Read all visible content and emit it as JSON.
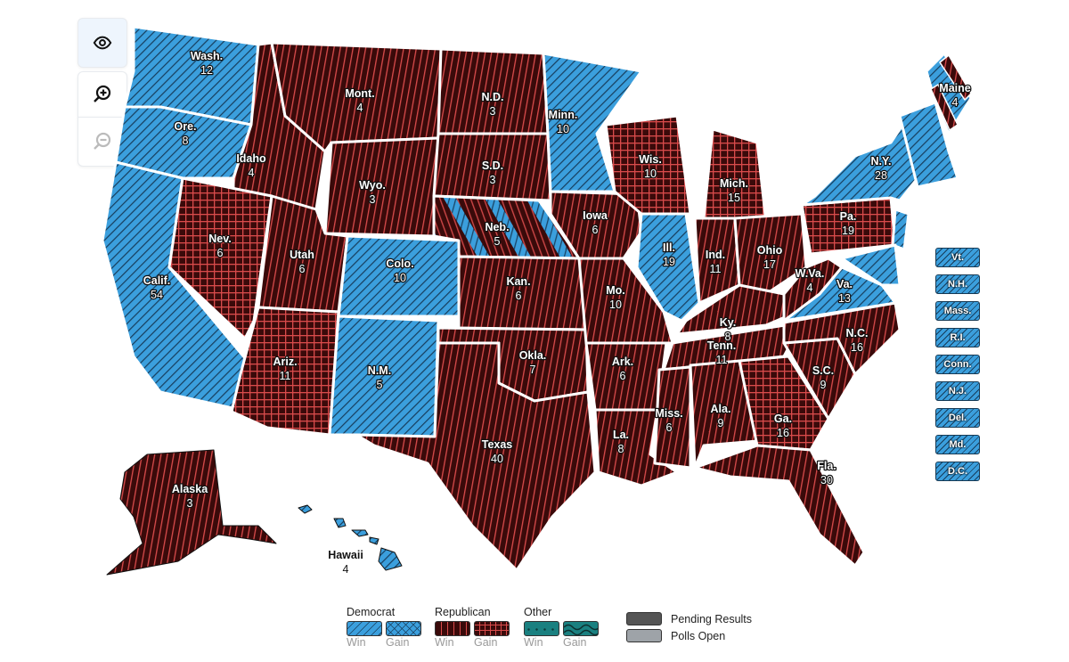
{
  "controls": {
    "view_icon": "eye-icon",
    "zoom_in_icon": "zoom-in-icon",
    "zoom_out_icon": "zoom-out-icon"
  },
  "colors": {
    "democrat": "#3b9fdd",
    "democrat_line": "#173d5c",
    "republican": "#3a0a0a",
    "republican_line": "#d94b4b",
    "other": "#1a8080",
    "pending": "#555555",
    "polls_open": "#9ea3a8"
  },
  "states": [
    {
      "abbr": "Wash.",
      "ev": "12",
      "party": "D",
      "status": "win"
    },
    {
      "abbr": "Ore.",
      "ev": "8",
      "party": "D",
      "status": "win"
    },
    {
      "abbr": "Calif.",
      "ev": "54",
      "party": "D",
      "status": "win"
    },
    {
      "abbr": "Idaho",
      "ev": "4",
      "party": "R",
      "status": "win"
    },
    {
      "abbr": "Nev.",
      "ev": "6",
      "party": "R",
      "status": "gain"
    },
    {
      "abbr": "Mont.",
      "ev": "4",
      "party": "R",
      "status": "win"
    },
    {
      "abbr": "Wyo.",
      "ev": "3",
      "party": "R",
      "status": "win"
    },
    {
      "abbr": "Utah",
      "ev": "6",
      "party": "R",
      "status": "win"
    },
    {
      "abbr": "Ariz.",
      "ev": "11",
      "party": "R",
      "status": "gain"
    },
    {
      "abbr": "Colo.",
      "ev": "10",
      "party": "D",
      "status": "win"
    },
    {
      "abbr": "N.M.",
      "ev": "5",
      "party": "D",
      "status": "win"
    },
    {
      "abbr": "N.D.",
      "ev": "3",
      "party": "R",
      "status": "win"
    },
    {
      "abbr": "S.D.",
      "ev": "3",
      "party": "R",
      "status": "win"
    },
    {
      "abbr": "Neb.",
      "ev": "5",
      "party": "R",
      "status": "split"
    },
    {
      "abbr": "Kan.",
      "ev": "6",
      "party": "R",
      "status": "win"
    },
    {
      "abbr": "Okla.",
      "ev": "7",
      "party": "R",
      "status": "win"
    },
    {
      "abbr": "Texas",
      "ev": "40",
      "party": "R",
      "status": "win"
    },
    {
      "abbr": "Minn.",
      "ev": "10",
      "party": "D",
      "status": "win"
    },
    {
      "abbr": "Iowa",
      "ev": "6",
      "party": "R",
      "status": "win"
    },
    {
      "abbr": "Mo.",
      "ev": "10",
      "party": "R",
      "status": "win"
    },
    {
      "abbr": "Ark.",
      "ev": "6",
      "party": "R",
      "status": "win"
    },
    {
      "abbr": "La.",
      "ev": "8",
      "party": "R",
      "status": "win"
    },
    {
      "abbr": "Wis.",
      "ev": "10",
      "party": "R",
      "status": "gain"
    },
    {
      "abbr": "Ill.",
      "ev": "19",
      "party": "D",
      "status": "win"
    },
    {
      "abbr": "Mich.",
      "ev": "15",
      "party": "R",
      "status": "gain"
    },
    {
      "abbr": "Ind.",
      "ev": "11",
      "party": "R",
      "status": "win"
    },
    {
      "abbr": "Ohio",
      "ev": "17",
      "party": "R",
      "status": "win"
    },
    {
      "abbr": "Ky.",
      "ev": "8",
      "party": "R",
      "status": "win"
    },
    {
      "abbr": "Tenn.",
      "ev": "11",
      "party": "R",
      "status": "win"
    },
    {
      "abbr": "Miss.",
      "ev": "6",
      "party": "R",
      "status": "win"
    },
    {
      "abbr": "Ala.",
      "ev": "9",
      "party": "R",
      "status": "win"
    },
    {
      "abbr": "Ga.",
      "ev": "16",
      "party": "R",
      "status": "gain"
    },
    {
      "abbr": "Fla.",
      "ev": "30",
      "party": "R",
      "status": "win"
    },
    {
      "abbr": "S.C.",
      "ev": "9",
      "party": "R",
      "status": "win"
    },
    {
      "abbr": "N.C.",
      "ev": "16",
      "party": "R",
      "status": "win"
    },
    {
      "abbr": "Va.",
      "ev": "13",
      "party": "D",
      "status": "win"
    },
    {
      "abbr": "W.Va.",
      "ev": "4",
      "party": "R",
      "status": "win"
    },
    {
      "abbr": "Pa.",
      "ev": "19",
      "party": "R",
      "status": "gain"
    },
    {
      "abbr": "N.Y.",
      "ev": "28",
      "party": "D",
      "status": "win"
    },
    {
      "abbr": "Maine",
      "ev": "4",
      "party": "D",
      "status": "split"
    },
    {
      "abbr": "Alaska",
      "ev": "3",
      "party": "R",
      "status": "win"
    },
    {
      "abbr": "Hawaii",
      "ev": "4",
      "party": "D",
      "status": "win"
    }
  ],
  "small_states": [
    {
      "abbr": "Vt.",
      "party": "D"
    },
    {
      "abbr": "N.H.",
      "party": "D"
    },
    {
      "abbr": "Mass.",
      "party": "D"
    },
    {
      "abbr": "R.I.",
      "party": "D"
    },
    {
      "abbr": "Conn.",
      "party": "D"
    },
    {
      "abbr": "N.J.",
      "party": "D"
    },
    {
      "abbr": "Del.",
      "party": "D"
    },
    {
      "abbr": "Md.",
      "party": "D"
    },
    {
      "abbr": "D.C.",
      "party": "D"
    }
  ],
  "legend": {
    "democrat": {
      "title": "Democrat",
      "win": "Win",
      "gain": "Gain"
    },
    "republican": {
      "title": "Republican",
      "win": "Win",
      "gain": "Gain"
    },
    "other": {
      "title": "Other",
      "win": "Win",
      "gain": "Gain"
    },
    "pending": "Pending Results",
    "polls_open": "Polls Open"
  }
}
